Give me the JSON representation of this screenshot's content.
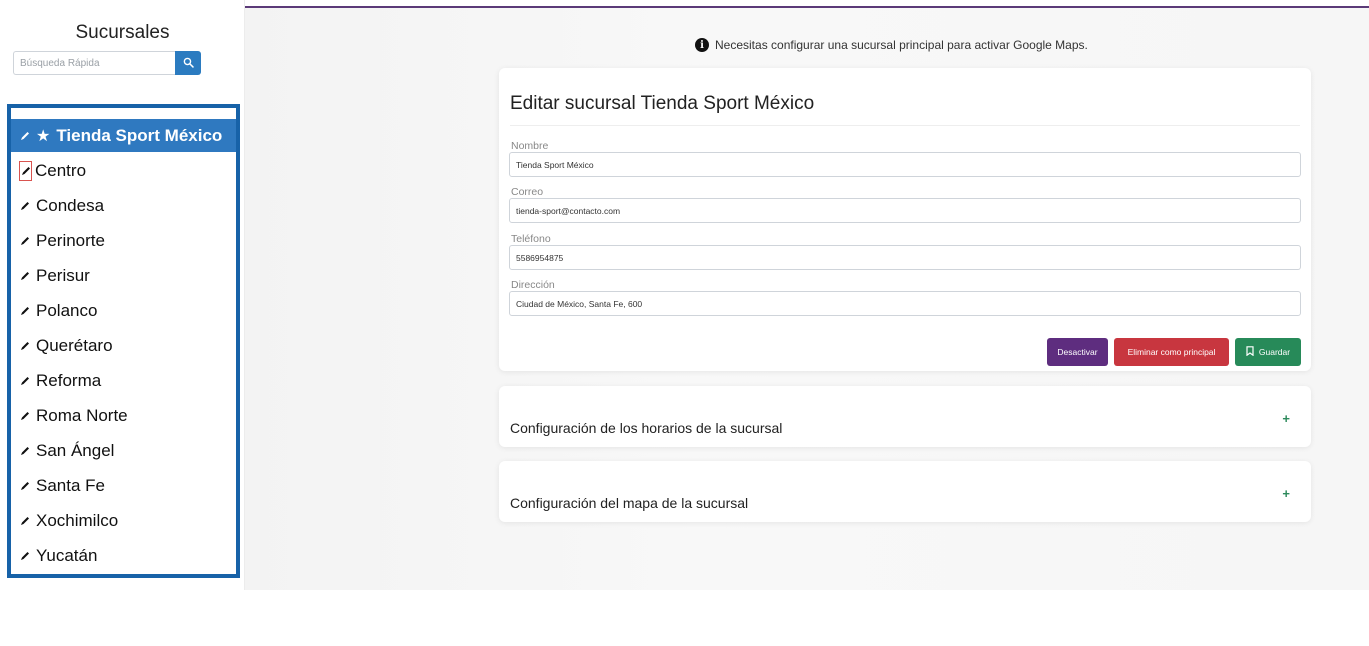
{
  "sidebar": {
    "title": "Sucursales",
    "search_placeholder": "Búsqueda Rápida",
    "items": [
      {
        "label": "Tienda Sport México",
        "active": true,
        "principal": true
      },
      {
        "label": "Centro"
      },
      {
        "label": "Condesa"
      },
      {
        "label": "Perinorte"
      },
      {
        "label": "Perisur"
      },
      {
        "label": "Polanco"
      },
      {
        "label": "Querétaro"
      },
      {
        "label": "Reforma"
      },
      {
        "label": "Roma Norte"
      },
      {
        "label": "San Ángel"
      },
      {
        "label": "Santa Fe"
      },
      {
        "label": "Xochimilco"
      },
      {
        "label": "Yucatán"
      }
    ]
  },
  "notice": {
    "icon": "info-icon",
    "text": "Necesitas configurar una sucursal principal para activar Google Maps."
  },
  "edit_card": {
    "title": "Editar sucursal Tienda Sport México",
    "fields": {
      "nombre": {
        "label": "Nombre",
        "value": "Tienda Sport México"
      },
      "correo": {
        "label": "Correo",
        "value": "tienda-sport@contacto.com"
      },
      "telefono": {
        "label": "Teléfono",
        "value": "5586954875"
      },
      "direccion": {
        "label": "Dirección",
        "value": "Ciudad de México, Santa Fe, 600"
      }
    },
    "buttons": {
      "deactivate": "Desactivar",
      "remove_principal": "Eliminar como principal",
      "save": "Guardar"
    }
  },
  "sections": {
    "hours": {
      "title": "Configuración de los horarios de la sucursal",
      "toggle": "+"
    },
    "map": {
      "title": "Configuración del mapa de la sucursal",
      "toggle": "+"
    }
  },
  "colors": {
    "primary": "#2f79c0",
    "list_border": "#1762a8",
    "deactivate": "#5e2d7f",
    "remove": "#c8363f",
    "save": "#278a59"
  }
}
